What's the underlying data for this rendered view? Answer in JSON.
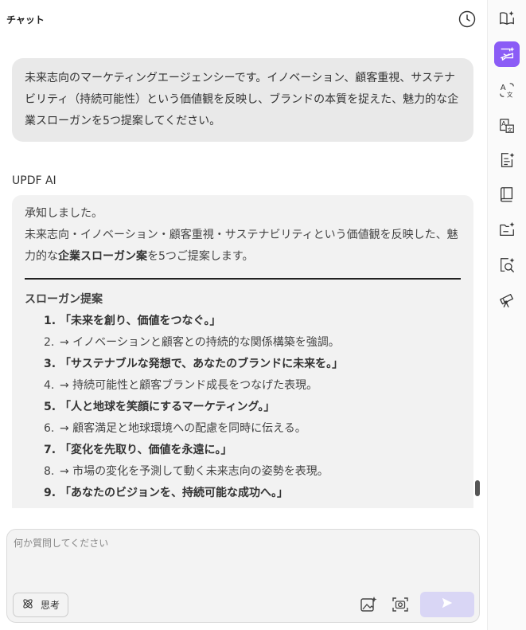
{
  "header": {
    "title": "チャット",
    "history_icon": "clock-icon"
  },
  "user_message": "未来志向のマーケティングエージェンシーです。イノベーション、顧客重視、サステナビリティ（持続可能性）という価値観を反映し、ブランドの本質を捉えた、魅力的な企業スローガンを5つ提案してください。",
  "ai": {
    "label": "UPDF AI",
    "intro": "承知しました。",
    "summary_prefix": "未来志向・イノベーション・顧客重視・サステナビリティという価値観を反映した、魅力的な",
    "summary_bold": "企業スローガン案",
    "summary_suffix": "を5つご提案します。",
    "heading": "スローガン提案",
    "slogans": [
      {
        "num": "1.",
        "text": "「未来を創り、価値をつなぐ。」",
        "bold": true
      },
      {
        "num": "2.",
        "text": "→ イノベーションと顧客との持続的な関係構築を強調。",
        "bold": false
      },
      {
        "num": "3.",
        "text": "「サステナブルな発想で、あなたのブランドに未来を。」",
        "bold": true
      },
      {
        "num": "4.",
        "text": "→ 持続可能性と顧客ブランド成長をつなげた表現。",
        "bold": false
      },
      {
        "num": "5.",
        "text": "「人と地球を笑顔にするマーケティング。」",
        "bold": true
      },
      {
        "num": "6.",
        "text": "→ 顧客満足と地球環境への配慮を同時に伝える。",
        "bold": false
      },
      {
        "num": "7.",
        "text": "「変化を先取り、価値を永遠に。」",
        "bold": true
      },
      {
        "num": "8.",
        "text": "→ 市場の変化を予測して動く未来志向の姿勢を表現。",
        "bold": false
      },
      {
        "num": "9.",
        "text": "「あなたのビジョンを、持続可能な成功へ。」",
        "bold": true
      }
    ]
  },
  "input": {
    "placeholder": "何か質問してください",
    "think_label": "思考",
    "think_icon": "atom-icon",
    "image_icon": "image-sparkle-icon",
    "screenshot_icon": "screenshot-icon",
    "send_icon": "send-icon"
  },
  "sidebar": {
    "items": [
      {
        "name": "book-sparkle-icon"
      },
      {
        "name": "ai-chat-icon",
        "active": true
      },
      {
        "name": "translate-icon"
      },
      {
        "name": "translate-box-icon"
      },
      {
        "name": "document-sparkle-icon"
      },
      {
        "name": "book-icon"
      },
      {
        "name": "folder-sparkle-icon"
      },
      {
        "name": "search-sparkle-icon"
      },
      {
        "name": "telescope-icon"
      }
    ]
  },
  "colors": {
    "accent": "#8b5cf6",
    "send_bg": "#d9d6f5",
    "bubble": "#e9e9e9",
    "card": "#f2f2f2"
  }
}
